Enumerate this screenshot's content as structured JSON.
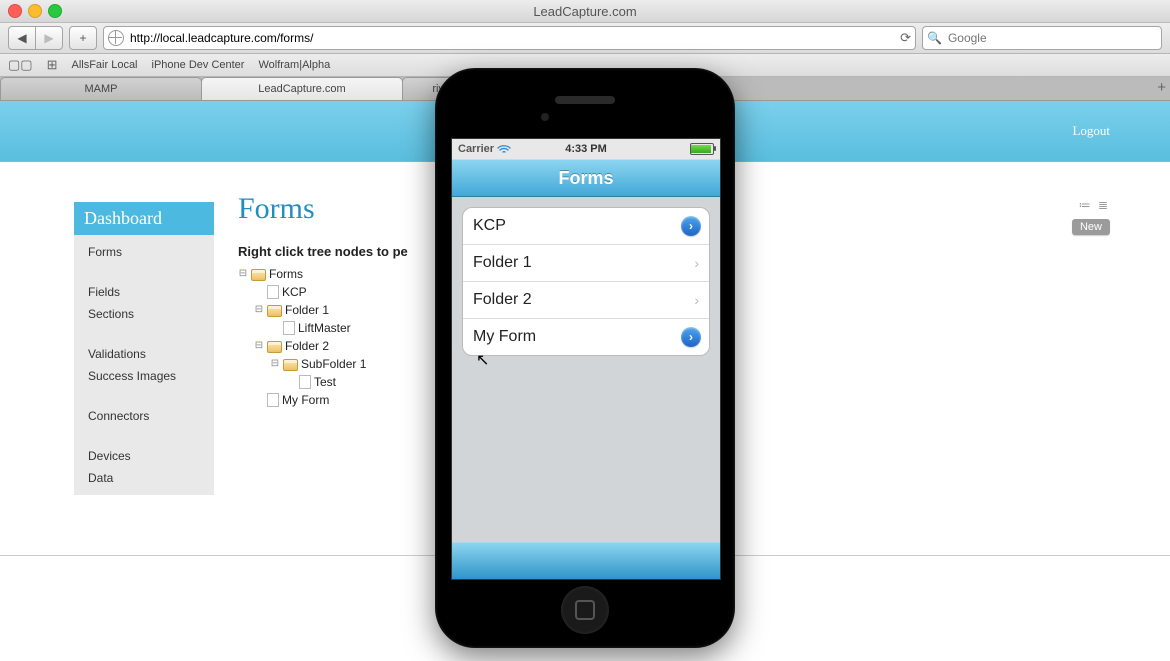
{
  "window": {
    "title": "LeadCapture.com"
  },
  "browser": {
    "url": "http://local.leadcapture.com/forms/",
    "search_placeholder": "Google",
    "bookmarks": [
      "AllsFair Local",
      "iPhone Dev Center",
      "Wolfram|Alpha"
    ],
    "tabs": [
      {
        "label": "MAMP",
        "active": false
      },
      {
        "label": "LeadCapture.com",
        "active": true
      },
      {
        "label": "river to river - Google Search",
        "active": false
      }
    ]
  },
  "page": {
    "logout_label": "Logout",
    "title": "Forms",
    "hint": "Right click tree nodes to pe",
    "new_button": "New"
  },
  "sidebar": {
    "header": "Dashboard",
    "items": [
      "Forms",
      "",
      "Fields",
      "Sections",
      "",
      "Validations",
      "Success Images",
      "",
      "Connectors",
      "",
      "Devices",
      "Data"
    ]
  },
  "tree": {
    "root": "Forms",
    "children": [
      {
        "type": "file",
        "label": "KCP"
      },
      {
        "type": "folder",
        "label": "Folder 1",
        "children": [
          {
            "type": "file",
            "label": "LiftMaster"
          }
        ]
      },
      {
        "type": "folder",
        "label": "Folder 2",
        "children": [
          {
            "type": "folder",
            "label": "SubFolder 1",
            "children": [
              {
                "type": "file",
                "label": "Test"
              }
            ]
          }
        ]
      },
      {
        "type": "file",
        "label": "My Form"
      }
    ]
  },
  "iphone": {
    "carrier": "Carrier",
    "time": "4:33 PM",
    "nav_title": "Forms",
    "list": [
      {
        "label": "KCP",
        "disclosure": "circle"
      },
      {
        "label": "Folder 1",
        "disclosure": "arrow"
      },
      {
        "label": "Folder 2",
        "disclosure": "arrow"
      },
      {
        "label": "My Form",
        "disclosure": "circle"
      }
    ]
  }
}
